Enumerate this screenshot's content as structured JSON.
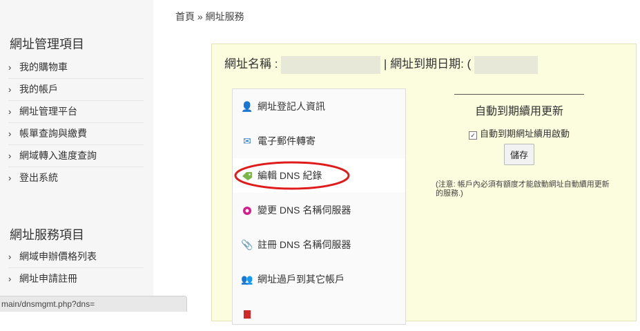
{
  "breadcrumb": {
    "home": "首頁",
    "sep": "»",
    "current": "網址服務"
  },
  "sidebar": {
    "manage_title": "網址管理項目",
    "manage_items": [
      {
        "label": "我的購物車"
      },
      {
        "label": "我的帳戶"
      },
      {
        "label": "網址管理平台"
      },
      {
        "label": "帳單查詢與繳費"
      },
      {
        "label": "網域轉入進度查詢"
      },
      {
        "label": "登出系統"
      }
    ],
    "service_title": "網址服務項目",
    "service_items": [
      {
        "label": "網域申辦價格列表"
      },
      {
        "label": "網址申請註冊"
      }
    ],
    "chevron": "›"
  },
  "domain_info": {
    "name_label": "網址名稱 :",
    "separator": "|",
    "expiry_label": "網址到期日期: (",
    "name_value": "",
    "expiry_value": ""
  },
  "menu": {
    "items": [
      {
        "label": "網址登記人資訊",
        "icon": "user-icon",
        "glyph": "👤",
        "color": "#d22828"
      },
      {
        "label": "電子郵件轉寄",
        "icon": "envelope-icon",
        "glyph": "✉",
        "color": "#2a7fd4"
      },
      {
        "label": "編輯 DNS 紀錄",
        "icon": "tag-icon",
        "glyph": "🏷",
        "color": "#7ab648"
      },
      {
        "label": "變更 DNS 名稱伺服器",
        "icon": "shield-icon",
        "glyph": "●",
        "color": "#d81b8c"
      },
      {
        "label": "註冊 DNS 名稱伺服器",
        "icon": "paperclip-icon",
        "glyph": "📎",
        "color": "#e8a020"
      },
      {
        "label": "網址過戶到其它帳戶",
        "icon": "users-icon",
        "glyph": "👥",
        "color": "#444444"
      },
      {
        "label": "",
        "icon": "document-icon",
        "glyph": "▮",
        "color": "#d22828"
      }
    ],
    "highlight_color": "#e01b1b"
  },
  "auto_renew": {
    "title": "自動到期續用更新",
    "checkbox_label": "自動到期網址續用啟動",
    "checked": true,
    "save_label": "儲存",
    "note": "(注意: 帳戶內必須有額度才能啟動網址自動續用更新的服務.)"
  },
  "status_url": "main/dnsmgmt.php?dns="
}
